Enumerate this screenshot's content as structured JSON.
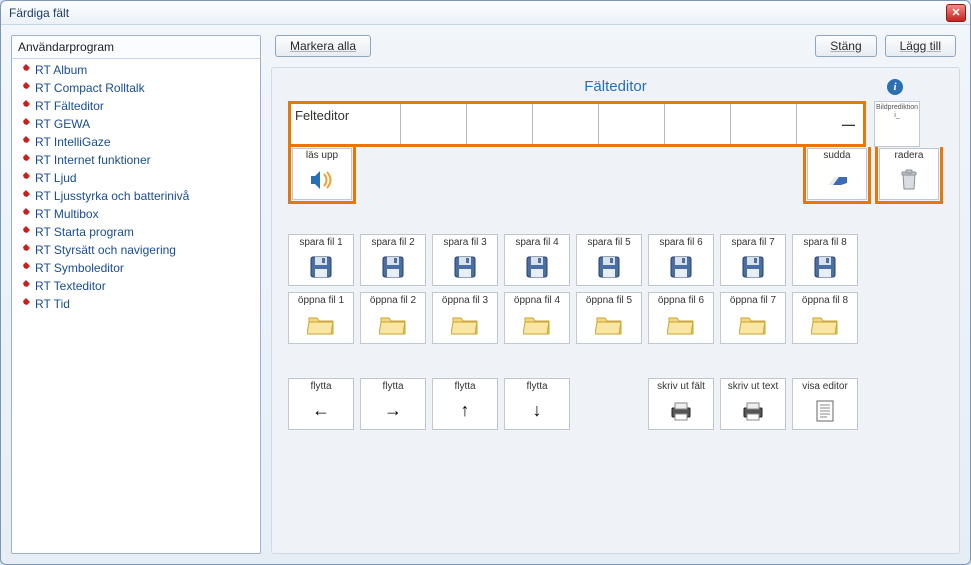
{
  "window": {
    "title": "Färdiga fält"
  },
  "sidebar": {
    "header": "Användarprogram",
    "items": [
      {
        "label": "RT Album"
      },
      {
        "label": "RT Compact Rolltalk"
      },
      {
        "label": "RT Fälteditor"
      },
      {
        "label": "RT GEWA"
      },
      {
        "label": "RT IntelliGaze"
      },
      {
        "label": "RT Internet funktioner"
      },
      {
        "label": "RT Ljud"
      },
      {
        "label": "RT Ljusstyrka och batterinivå"
      },
      {
        "label": "RT Multibox"
      },
      {
        "label": "RT Starta program"
      },
      {
        "label": "RT Styrsätt och navigering"
      },
      {
        "label": "RT Symboleditor"
      },
      {
        "label": "RT Texteditor"
      },
      {
        "label": "RT Tid"
      }
    ]
  },
  "toolbar": {
    "mark_all": "Markera alla",
    "close": "Stäng",
    "add": "Lägg till"
  },
  "editor": {
    "title": "Fälteditor",
    "first_cell_text": "Felteditor",
    "dash": "—",
    "bp_label": "Bildprediktion",
    "bp_sub": "i_",
    "actions": {
      "speak": "läs upp",
      "erase": "sudda",
      "delete": "radera"
    }
  },
  "save_tiles": [
    "spara fil 1",
    "spara fil 2",
    "spara fil 3",
    "spara fil 4",
    "spara fil 5",
    "spara fil 6",
    "spara fil 7",
    "spara fil 8"
  ],
  "open_tiles": [
    "öppna fil 1",
    "öppna fil 2",
    "öppna fil 3",
    "öppna fil 4",
    "öppna fil 5",
    "öppna fil 6",
    "öppna fil 7",
    "öppna fil 8"
  ],
  "move_tiles": {
    "base": "flytta",
    "arrows": [
      "←",
      "→",
      "↑",
      "↓"
    ]
  },
  "bottom_tiles": {
    "print_field": "skriv ut fält",
    "print_text": "skriv ut text",
    "show_editor": "visa editor"
  }
}
